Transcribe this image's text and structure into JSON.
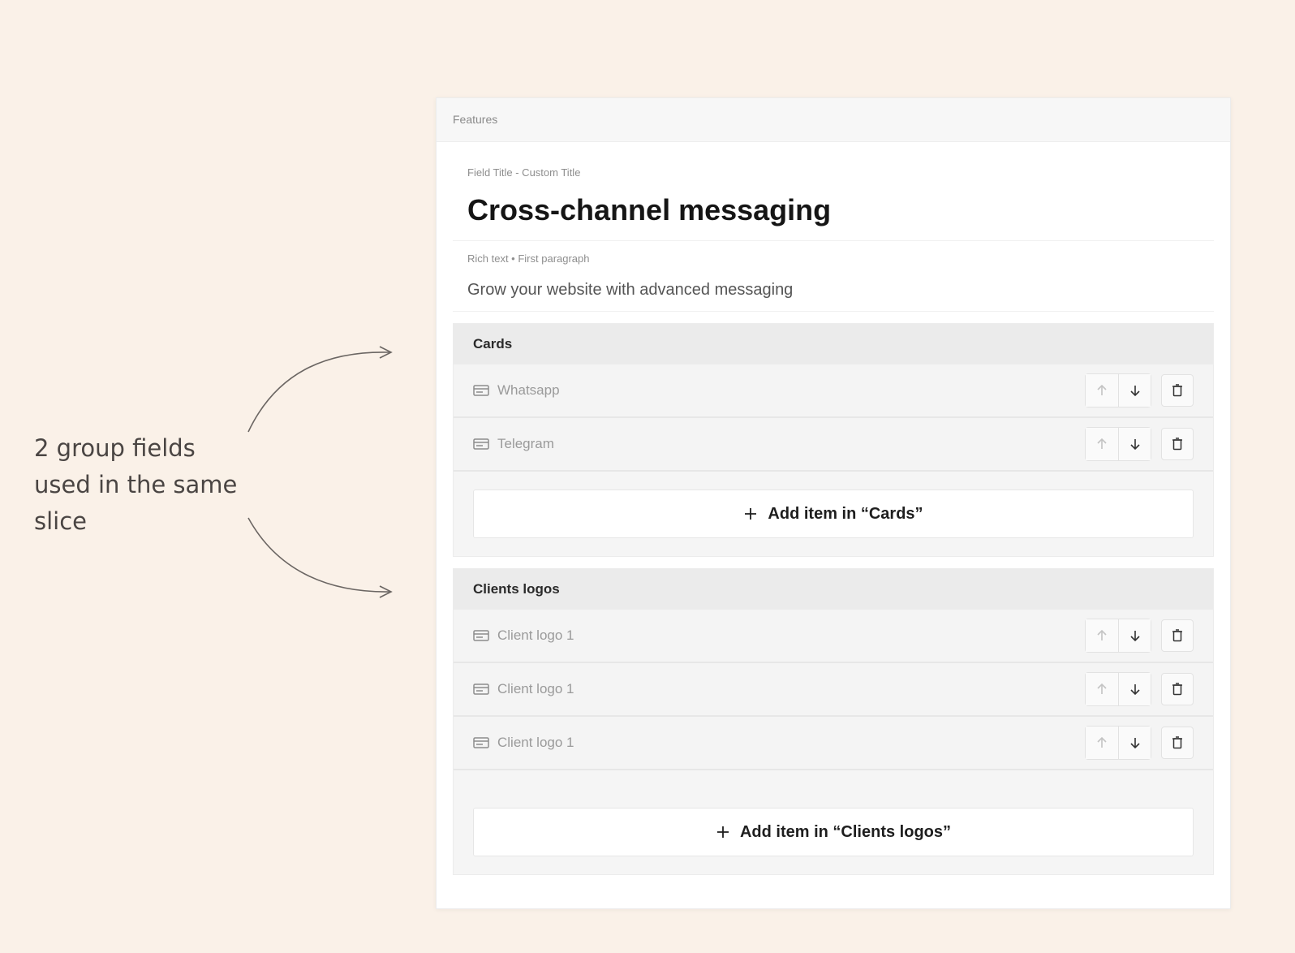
{
  "annotation": {
    "text_line1": "2 group fields",
    "text_line2": "used in the same",
    "text_line3": "slice"
  },
  "panel": {
    "header": "Features",
    "title_field": {
      "label": "Field Title - Custom Title",
      "value": "Cross-channel messaging"
    },
    "rich_text_field": {
      "label": "Rich text • First paragraph",
      "value": "Grow your website with advanced messaging"
    },
    "groups": [
      {
        "name": "Cards",
        "items": [
          {
            "label": "Whatsapp"
          },
          {
            "label": "Telegram"
          }
        ],
        "add_label": "Add item in “Cards”"
      },
      {
        "name": "Clients logos",
        "items": [
          {
            "label": "Client logo 1"
          },
          {
            "label": "Client logo 1"
          },
          {
            "label": "Client logo 1"
          }
        ],
        "add_label": "Add item in “Clients logos”"
      }
    ]
  },
  "icons": {
    "row": "card-icon",
    "up": "arrow-up-icon",
    "down": "arrow-down-icon",
    "delete": "trash-icon",
    "add": "plus-icon"
  },
  "colors": {
    "background": "#faf1e8",
    "panel": "#ffffff",
    "group_header": "#ebebeb"
  }
}
